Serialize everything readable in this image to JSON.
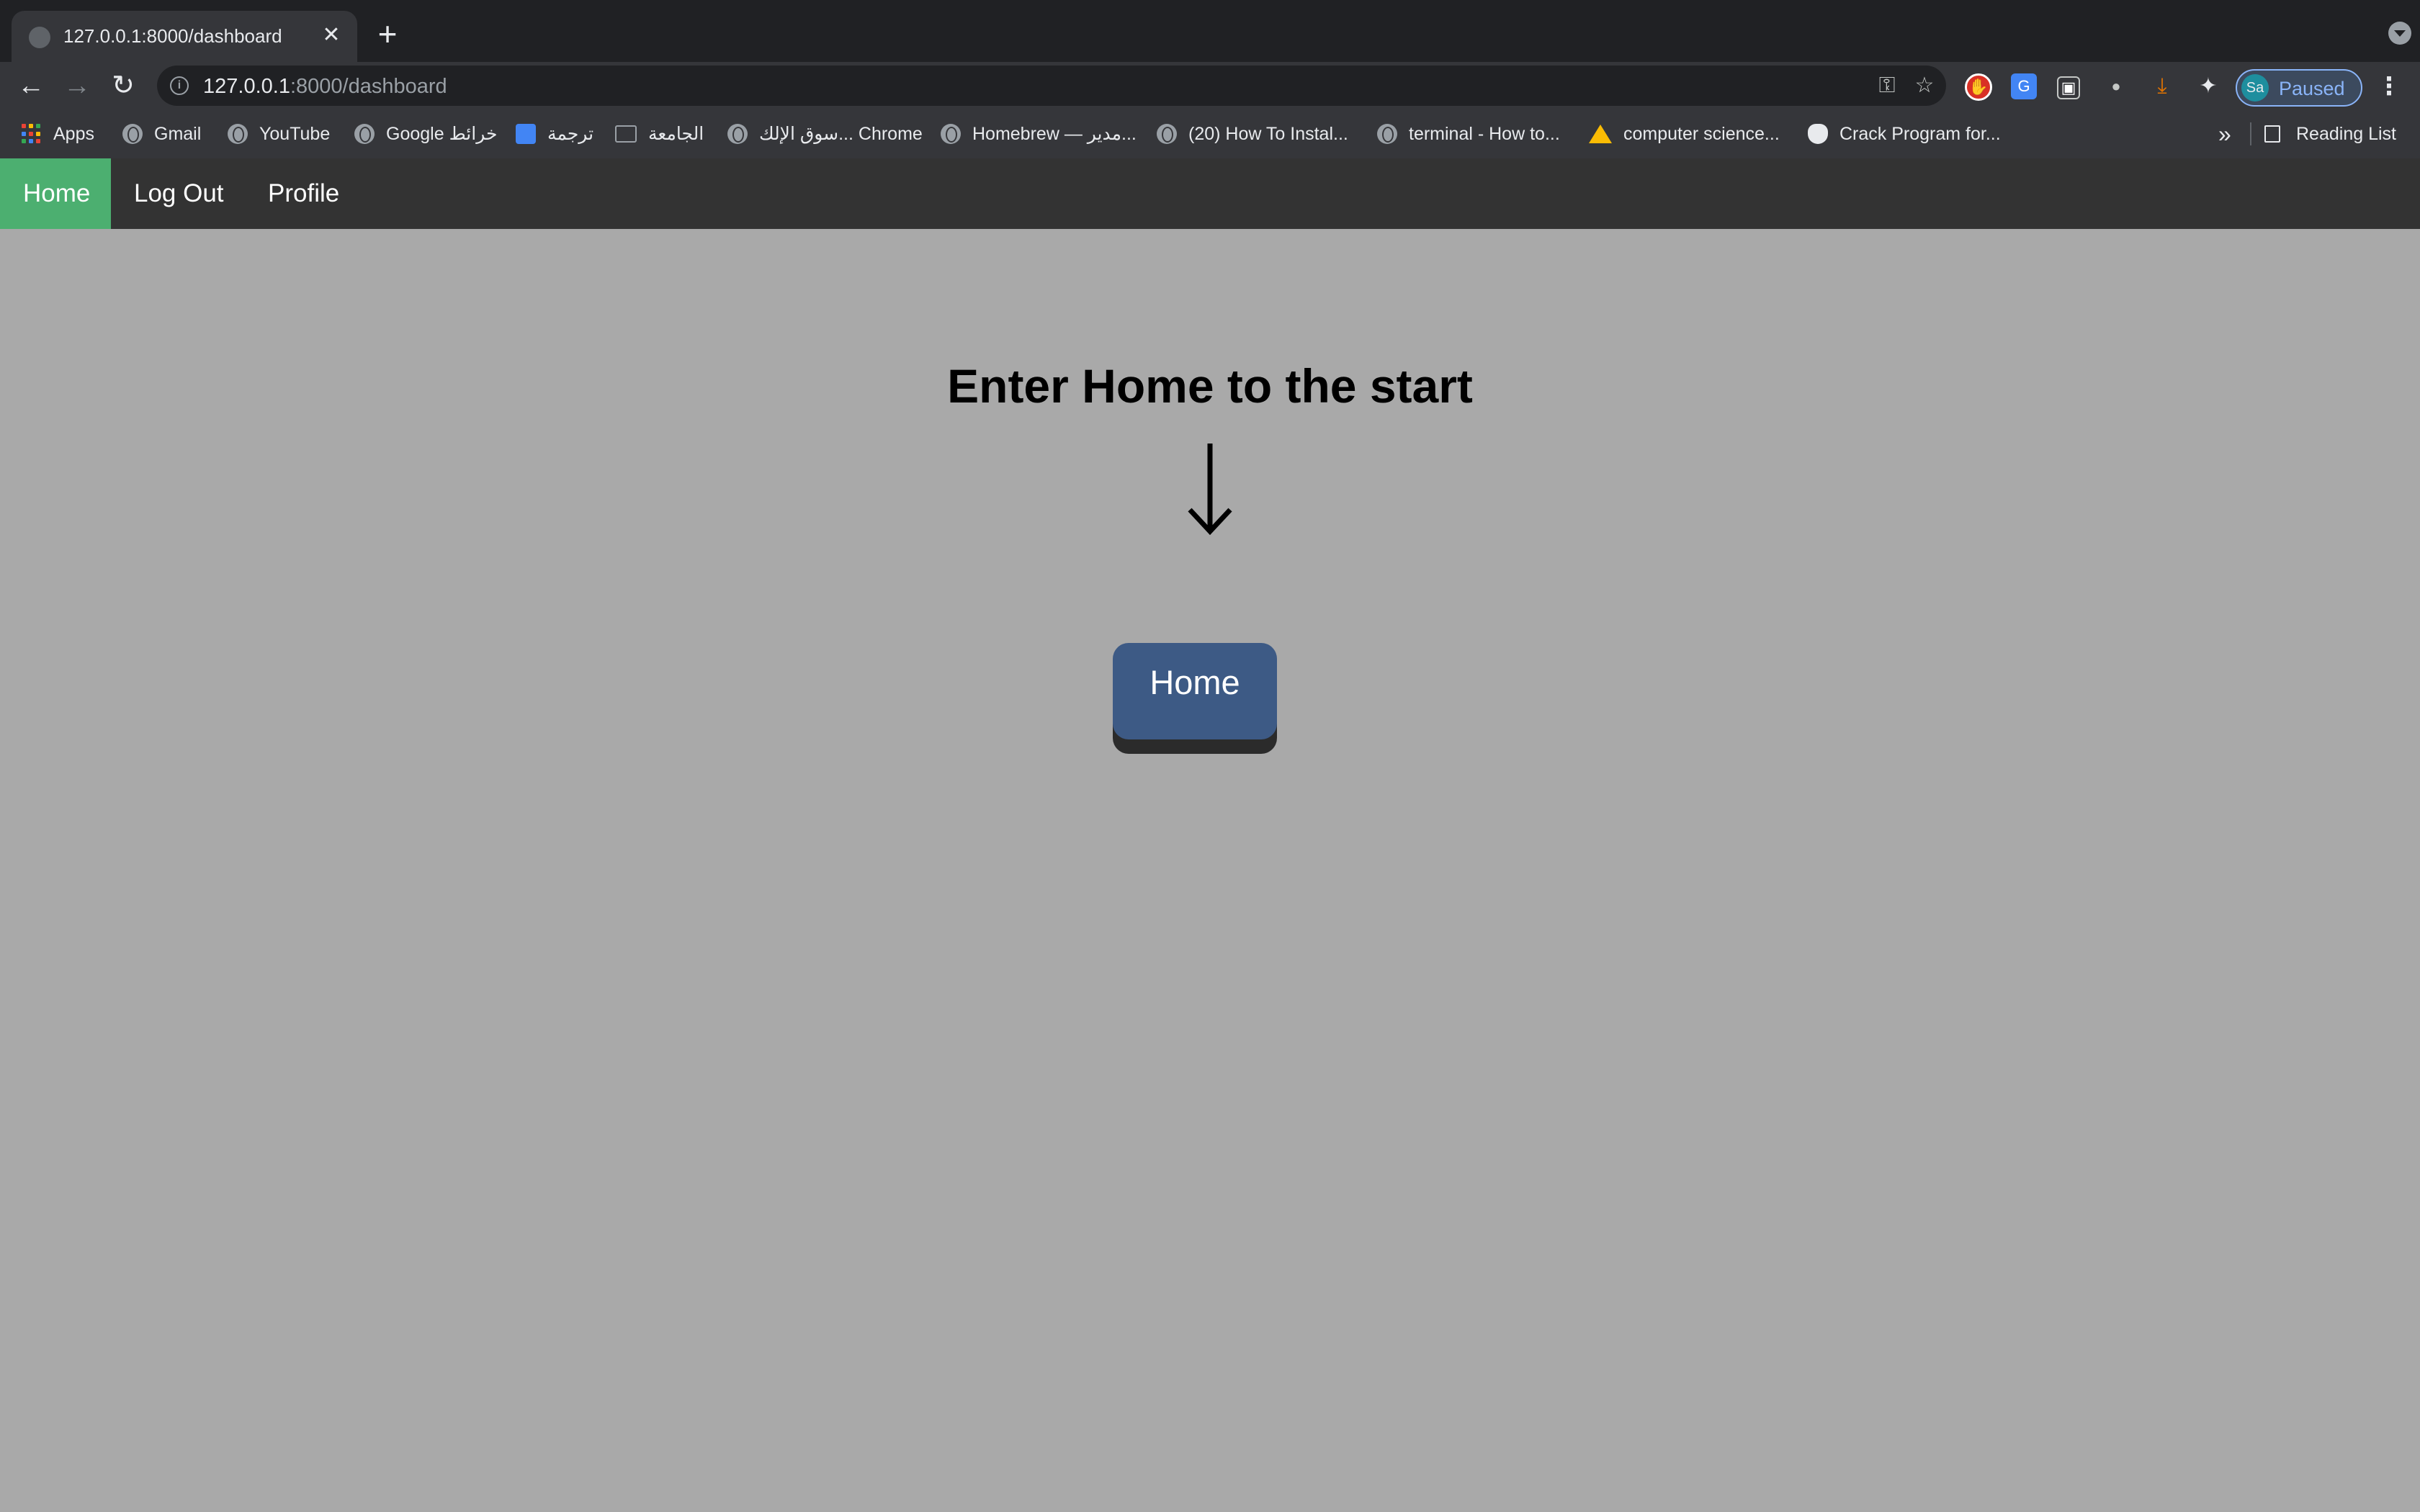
{
  "browser": {
    "tab": {
      "title": "127.0.0.1:8000/dashboard",
      "close_glyph": "✕"
    },
    "new_tab_glyph": "+",
    "address_bar": {
      "host": "127.0.0.1",
      "path": ":8000/dashboard"
    },
    "profile": {
      "initials": "Sa",
      "status": "Paused"
    },
    "bookmarks": [
      {
        "label": "Apps",
        "icon": "apps-grid-icon"
      },
      {
        "label": "Gmail",
        "icon": "globe-icon"
      },
      {
        "label": "YouTube",
        "icon": "globe-icon"
      },
      {
        "label": "Google خرائط",
        "icon": "globe-icon"
      },
      {
        "label": "ترجمة",
        "icon": "translate-icon"
      },
      {
        "label": "الجامعة",
        "icon": "folder-icon"
      },
      {
        "label": "سوق الإلك... Chrome",
        "icon": "globe-icon"
      },
      {
        "label": "Homebrew — مدير...",
        "icon": "globe-icon"
      },
      {
        "label": "(20) How To Instal...",
        "icon": "globe-icon"
      },
      {
        "label": "terminal - How to...",
        "icon": "globe-icon"
      },
      {
        "label": "computer science...",
        "icon": "drive-icon"
      },
      {
        "label": "Crack Program for...",
        "icon": "apple-icon"
      }
    ],
    "bookmarks_overflow": "»",
    "reading_list": "Reading List"
  },
  "site": {
    "nav": [
      {
        "label": "Home",
        "active": true
      },
      {
        "label": "Log Out",
        "active": false
      },
      {
        "label": "Profile",
        "active": false
      }
    ],
    "heading": "Enter Home to the start",
    "home_button": "Home",
    "colors": {
      "background": "#a9a9a9",
      "navbar": "#333333",
      "nav_active": "#4caf70",
      "button": "#3d5a85"
    }
  }
}
